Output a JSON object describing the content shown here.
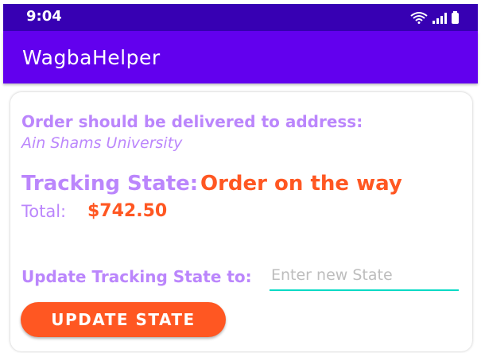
{
  "status_bar": {
    "time": "9:04",
    "icons": [
      "wifi-icon",
      "signal-icon",
      "battery-icon"
    ]
  },
  "app_bar": {
    "title": "WagbaHelper"
  },
  "order": {
    "deliver_label": "Order should be delivered to address:",
    "address": "Ain Shams University",
    "tracking_label": "Tracking State:",
    "tracking_value": "Order on the way",
    "total_label": "Total:",
    "total_value": "$742.50"
  },
  "update": {
    "label": "Update Tracking State to:",
    "input_placeholder": "Enter new State",
    "input_value": "",
    "button_label": "UPDATE STATE"
  },
  "colors": {
    "status_bar": "#3700b3",
    "app_bar": "#6200ee",
    "label_purple": "#bb86fc",
    "accent_orange": "#ff5722",
    "input_underline": "#03dac5"
  }
}
